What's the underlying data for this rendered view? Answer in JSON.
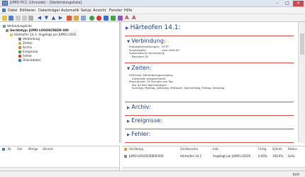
{
  "window": {
    "title": "JUMO PCC (Unicode) - [Verbindungsliste]"
  },
  "menu": [
    "Datei",
    "Editieren",
    "Datenträger",
    "Automatik",
    "Setup",
    "Ansicht",
    "Fenster",
    "Hilfe"
  ],
  "tree": {
    "root": "Verbindungsliste",
    "device": "Gerätetyp: JUMO LOGOSCREEN 600",
    "connection": "Härteofen 14.1: Angelegt per JUMO LOGO",
    "children": [
      "Verbindung",
      "Zeiten",
      "Archiv",
      "Ereignisse",
      "Fehler",
      "Onlinedaten"
    ]
  },
  "detail": {
    "title": "Härteofen 14.1:",
    "sections": [
      {
        "label": "Verbindung:"
      },
      {
        "label": "Zeiten:"
      },
      {
        "label": "Archiv:"
      },
      {
        "label": "Ereignisse:"
      },
      {
        "label": "Fehler:"
      }
    ],
    "verbindung": {
      "rows": [
        {
          "key": "Protokolleinstellungen:",
          "value": "HTTP"
        },
        {
          "key": "Schnittstelle:",
          "value": "com=800:00"
        },
        {
          "key": "Automatische Anmeldung:",
          "value": ""
        },
        {
          "key": "Benutzer ID:",
          "value": ""
        }
      ]
    },
    "zeiten": {
      "lines": [
        "Zeitlicher Steuerbezugsvorgang:",
        "Automatik ausgeschaltet",
        "Startuhrzeit:  24 Stunden am Tag",
        "Nur an den Wochentagen:",
        "Sonntag, Montag, Dienstag, Mittwoch, Donnerstag, Freitag, Samstag"
      ]
    }
  },
  "bottom_left": {
    "headers": [
      "Nr.",
      "Ziel",
      "Menge",
      "Uhrzeit"
    ]
  },
  "bottom_right": {
    "headers": [
      "Gerätetyp",
      "Gerätename",
      "Info",
      "Fertig",
      "Schritt",
      "Status"
    ],
    "row": [
      "JUMO LOGOSCREEN 600",
      "Härteofen 14.1",
      "Angelegt per JUMO LOGOS",
      "0.00%",
      "100.0%",
      "Scha"
    ]
  },
  "status": {
    "text": "NUM"
  },
  "colors": {
    "accent": "#1e3f8a",
    "divider": "#d84a4a",
    "link_triangle": "#2a55c4"
  }
}
